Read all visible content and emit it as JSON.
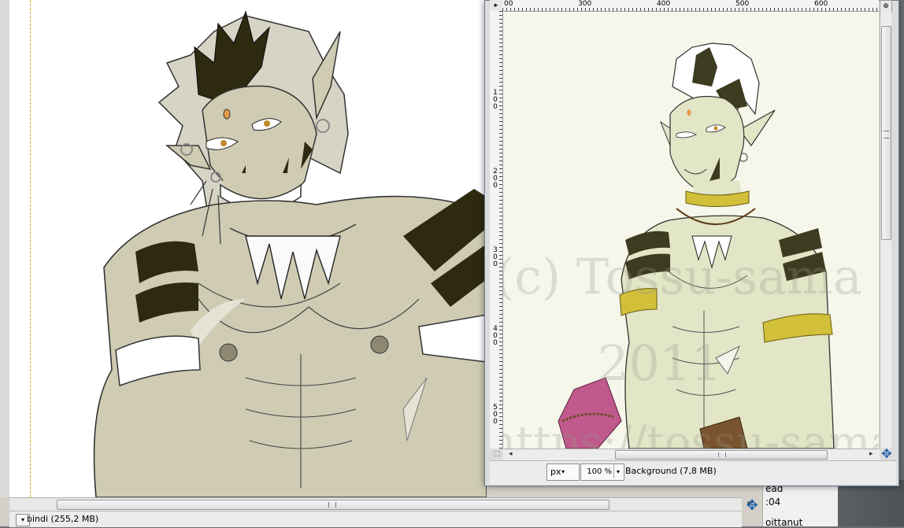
{
  "main_window": {
    "status_combo_arrow": "▾",
    "status_text": "bindi (255,2 MB)",
    "nav_icon": "move-cross-icon",
    "scroll_right_arrow": "▸"
  },
  "side_panel": {
    "line1": "ead",
    "line2": ":04",
    "line3": "oittanut"
  },
  "preview_window": {
    "ruler_corner": "▸",
    "zoom_button": "⊕",
    "h_ruler_labels": [
      "00",
      "300",
      "400",
      "500",
      "600"
    ],
    "v_ruler_labels": [
      "100",
      "200",
      "300",
      "400",
      "500"
    ],
    "watermark_lines": [
      "(c) Tossu-sama",
      "2011",
      "https://tossu-sama"
    ],
    "unit": "px",
    "unit_arrow": "▾",
    "zoom": "100 %",
    "zoom_arrow": "▾",
    "layer_status": "Background (7,8 MB)",
    "scroll_left_arrow": "◂",
    "scroll_right_arrow": "▸",
    "quick_mask_icon": "⬚",
    "nav_icon": "move-cross-icon"
  },
  "colors": {
    "skin_main": "#cfccb3",
    "dark_stripe": "#2e2a10",
    "preview_skin": "#e2e5c6",
    "gold_band": "#d2bf3a",
    "pink_wrap": "#c05a8c"
  }
}
